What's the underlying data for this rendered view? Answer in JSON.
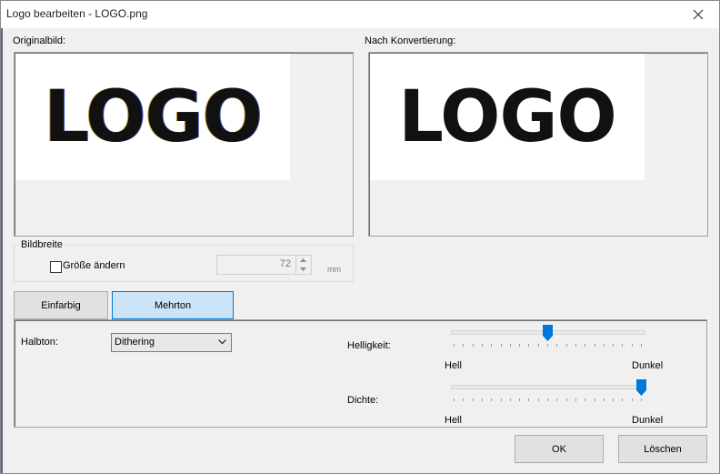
{
  "window": {
    "title": "Logo bearbeiten - LOGO.png"
  },
  "original": {
    "label": "Originalbild:",
    "logo_text": "LOGO"
  },
  "converted": {
    "label": "Nach Konvertierung:",
    "logo_text": "LOGO"
  },
  "image_width": {
    "group_label": "Bildbreite",
    "resize_label": "Größe ändern",
    "resize_checked": false,
    "value": "72",
    "unit": "mm"
  },
  "tabs": [
    {
      "label": "Einfarbig",
      "selected": false
    },
    {
      "label": "Mehrton",
      "selected": true
    }
  ],
  "halftone": {
    "label": "Halbton:",
    "selected": "Dithering"
  },
  "brightness": {
    "label": "Helligkeit:",
    "min_label": "Hell",
    "max_label": "Dunkel",
    "level": 0.5
  },
  "density": {
    "label": "Dichte:",
    "min_label": "Hell",
    "max_label": "Dunkel",
    "level": 1.0
  },
  "buttons": {
    "ok": "OK",
    "delete": "Löschen"
  },
  "colors": {
    "accent": "#0078d7",
    "selected_tab": "#cce4f7"
  }
}
